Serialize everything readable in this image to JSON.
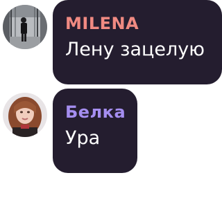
{
  "messages": [
    {
      "author": "MILENA",
      "author_color": "#f08a82",
      "text": "Лену зацелую",
      "avatar_icon": "avatar-photo-person-walking"
    },
    {
      "author": "Белка",
      "author_color": "#a58ef0",
      "text": "Ура",
      "avatar_icon": "avatar-photo-girl"
    }
  ],
  "colors": {
    "bubble_bg": "#241d2f",
    "text": "#ffffff",
    "page_bg": "#ffffff"
  }
}
